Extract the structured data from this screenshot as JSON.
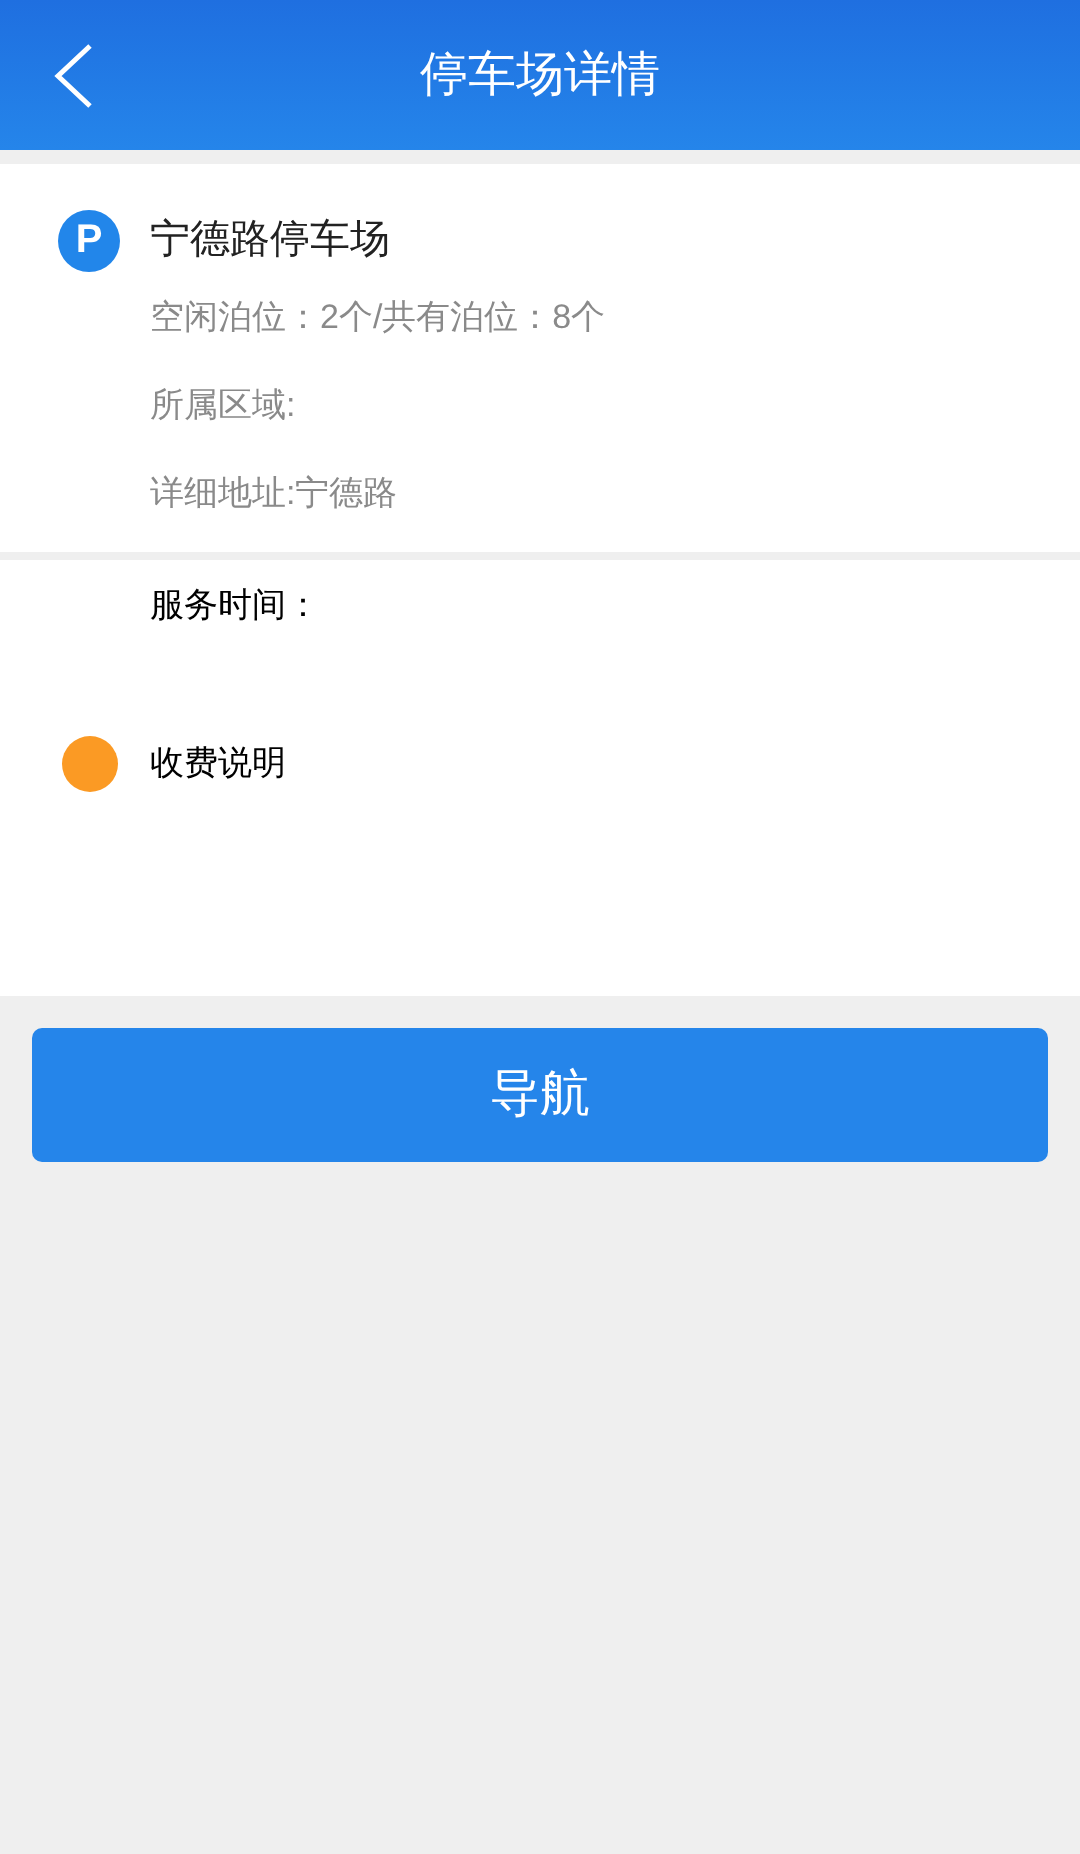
{
  "header": {
    "title": "停车场详情"
  },
  "lot": {
    "badge": "P",
    "name": "宁德路停车场",
    "details": [
      "空闲泊位：2个/共有泊位：8个",
      "所属区域:",
      "详细地址:宁德路"
    ]
  },
  "service": {
    "label": "服务时间："
  },
  "fees": {
    "label": "收费说明"
  },
  "nav_button": "导航"
}
